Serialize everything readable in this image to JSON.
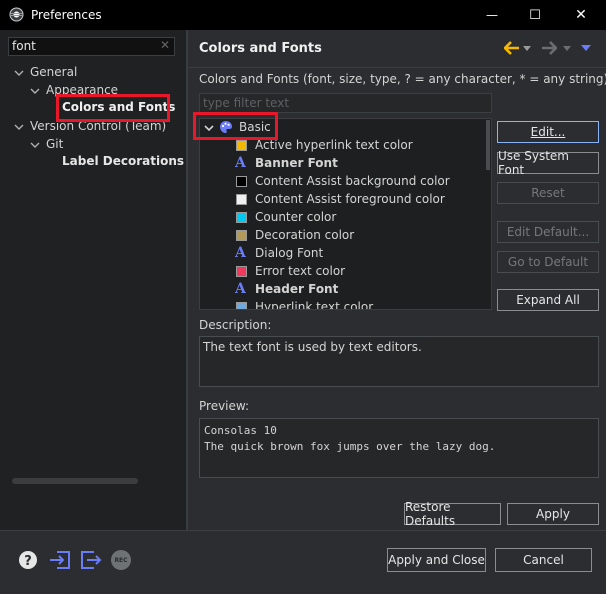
{
  "window": {
    "title": "Preferences",
    "minimize": "—",
    "maximize": "☐",
    "close": "✕"
  },
  "left": {
    "search_value": "font",
    "search_clear": "✕",
    "tree": [
      {
        "label": "General"
      },
      {
        "label": "Appearance"
      },
      {
        "label": "Colors and Fonts"
      },
      {
        "label": "Version Control (Team)"
      },
      {
        "label": "Git"
      },
      {
        "label": "Label Decorations"
      }
    ]
  },
  "page": {
    "title": "Colors and Fonts",
    "description_line": "Colors and Fonts (font, size, type, ? = any character, * = any string) :",
    "filter_placeholder": "type filter text",
    "category": "Basic",
    "items": [
      {
        "label": "Active hyperlink text color",
        "kind": "color",
        "color": "#f5b800",
        "bold": false
      },
      {
        "label": "Banner Font",
        "kind": "font",
        "bold": true
      },
      {
        "label": "Content Assist background color",
        "kind": "color",
        "color": "#000000",
        "bold": false
      },
      {
        "label": "Content Assist foreground color",
        "kind": "color",
        "color": "#f0f0f0",
        "bold": false
      },
      {
        "label": "Counter color",
        "kind": "color",
        "color": "#00c8f0",
        "bold": false
      },
      {
        "label": "Decoration color",
        "kind": "color",
        "color": "#b39a58",
        "bold": false
      },
      {
        "label": "Dialog Font",
        "kind": "font",
        "bold": false
      },
      {
        "label": "Error text color",
        "kind": "color",
        "color": "#ef3a5d",
        "bold": false
      },
      {
        "label": "Header Font",
        "kind": "font",
        "bold": true
      },
      {
        "label": "Hyperlink text color",
        "kind": "color",
        "color": "#6fa8dc",
        "bold": false
      }
    ],
    "buttons": {
      "edit": "Edit...",
      "use_system_font": "Use System Font",
      "reset": "Reset",
      "edit_default": "Edit Default...",
      "go_to_default": "Go to Default",
      "expand_all": "Expand All"
    },
    "description_label": "Description:",
    "description_text": "The text font is used by text editors.",
    "preview_label": "Preview:",
    "preview_lines": [
      "Consolas 10",
      "The quick brown fox jumps over the lazy dog."
    ],
    "restore_defaults": "Restore Defaults",
    "apply": "Apply"
  },
  "footer": {
    "apply_and_close": "Apply and Close",
    "cancel": "Cancel",
    "rec_label": "REC"
  },
  "colors": {
    "highlight": "#e8182a",
    "accent": "#6a7cf8",
    "back_arrow": "#f5b800"
  }
}
